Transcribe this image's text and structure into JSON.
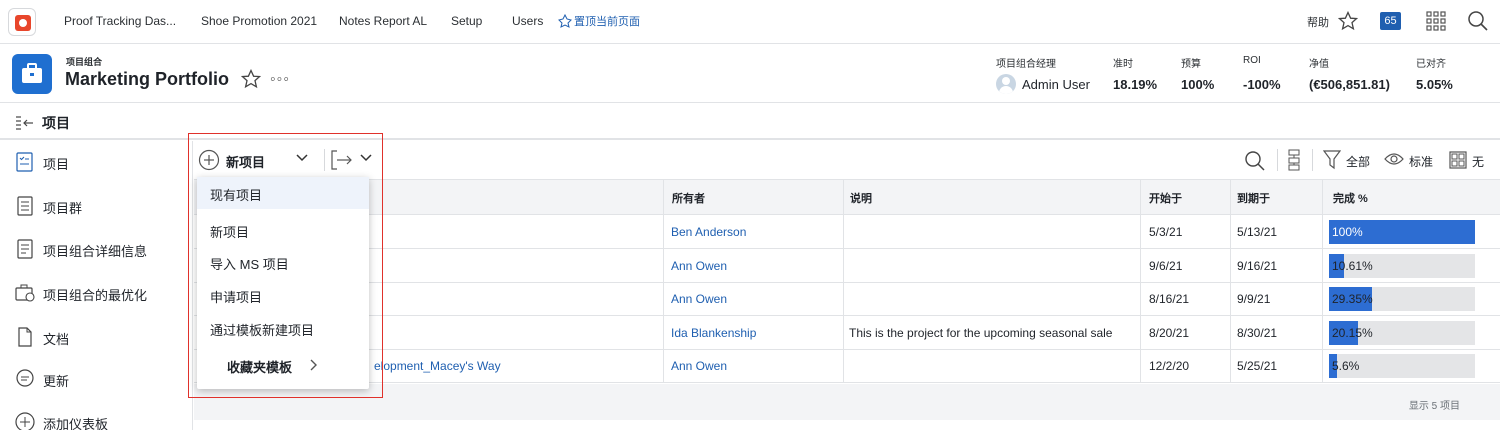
{
  "topnav": {
    "items": [
      "Proof Tracking Das...",
      "Shoe Promotion 2021",
      "Notes Report AL",
      "Setup",
      "Users"
    ],
    "pin_label": "置顶当前页面",
    "help": "帮助",
    "badge": "65"
  },
  "header": {
    "type_label": "项目组合",
    "title": "Marketing Portfolio",
    "stats": [
      {
        "label": "项目组合经理",
        "value": "Admin User"
      },
      {
        "label": "准时",
        "value": "18.19%"
      },
      {
        "label": "预算",
        "value": "100%"
      },
      {
        "label": "ROI",
        "value": "-100%"
      },
      {
        "label": "净值",
        "value": "(€506,851.81)"
      },
      {
        "label": "已对齐",
        "value": "5.05%"
      }
    ]
  },
  "sidebar": {
    "title": "项目",
    "items": [
      "项目",
      "项目群",
      "项目组合详细信息",
      "项目组合的最优化",
      "文档",
      "更新",
      "添加仪表板"
    ]
  },
  "toolbar": {
    "new_label": "新项目",
    "filter_label": "全部",
    "view_label": "标准",
    "group_label": "无"
  },
  "dropdown": {
    "items": [
      "现有项目",
      "新项目",
      "导入 MS 项目",
      "申请项目",
      "通过模板新建项目"
    ],
    "favorites": "收藏夹模板"
  },
  "table": {
    "headers": [
      "所有者",
      "说明",
      "开始于",
      "到期于",
      "完成 %"
    ],
    "rows": [
      {
        "name": "",
        "owner": "Ben Anderson",
        "desc": "",
        "start": "5/3/21",
        "due": "5/13/21",
        "pct_label": "100%",
        "pct": 100
      },
      {
        "name": "",
        "owner": "Ann Owen",
        "desc": "",
        "start": "9/6/21",
        "due": "9/16/21",
        "pct_label": "10.61%",
        "pct": 10.61
      },
      {
        "name": "",
        "owner": "Ann Owen",
        "desc": "",
        "start": "8/16/21",
        "due": "9/9/21",
        "pct_label": "29.35%",
        "pct": 29.35
      },
      {
        "name": "",
        "owner": "Ida Blankenship",
        "desc": "This is the project for the upcoming seasonal sale",
        "start": "8/20/21",
        "due": "8/30/21",
        "pct_label": "20.15%",
        "pct": 20.15
      },
      {
        "name": "elopment_Macey's Way",
        "owner": "Ann Owen",
        "desc": "",
        "start": "12/2/20",
        "due": "5/25/21",
        "pct_label": "5.6%",
        "pct": 5.6
      }
    ],
    "footer": "显示 5 项目"
  },
  "colors": {
    "accent": "#1f5fb0",
    "bar": "#2d6dd2",
    "highlight_box": "#e0312b"
  }
}
